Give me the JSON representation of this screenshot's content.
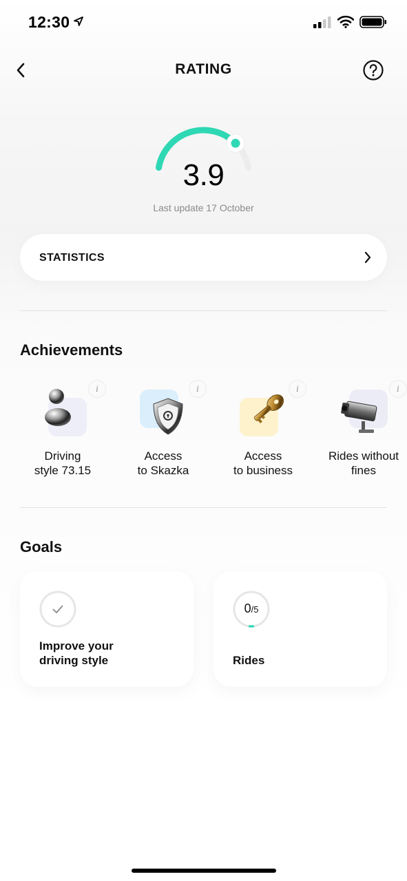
{
  "status_bar": {
    "time": "12:30",
    "icons": [
      "location-arrow-icon",
      "cellular-signal-icon",
      "wifi-icon",
      "battery-icon"
    ]
  },
  "nav": {
    "title": "RATING",
    "back_icon": "chevron-left-icon",
    "help_icon": "question-circle-icon"
  },
  "rating": {
    "value": "3.9",
    "gauge_fraction": 0.78,
    "last_update": "Last update 17 October",
    "accent_color": "#2fd8b4"
  },
  "statistics": {
    "label": "STATISTICS",
    "icon": "chevron-right-icon"
  },
  "achievements": {
    "title": "Achievements",
    "items": [
      {
        "label_line1": "Driving",
        "label_line2": "style 73.15",
        "icon": "driver-figure-icon",
        "tile_color": "#eeeef8",
        "info": "i"
      },
      {
        "label_line1": "Access",
        "label_line2": "to Skazka",
        "icon": "shield-icon",
        "tile_color": "#dbeefb",
        "info": "i"
      },
      {
        "label_line1": "Access",
        "label_line2": "to business",
        "icon": "key-icon",
        "tile_color": "#fdf2cc",
        "info": "i"
      },
      {
        "label_line1": "Rides without",
        "label_line2": "fines",
        "icon": "camera-icon",
        "tile_color": "#ececf6",
        "info": "i"
      }
    ]
  },
  "goals": {
    "title": "Goals",
    "items": [
      {
        "label_line1": "Improve your",
        "label_line2": "driving style",
        "icon": "checkmark-icon"
      },
      {
        "label": "Rides",
        "progress_current": "0",
        "progress_total": "/5",
        "progress_fraction": 0
      }
    ]
  }
}
